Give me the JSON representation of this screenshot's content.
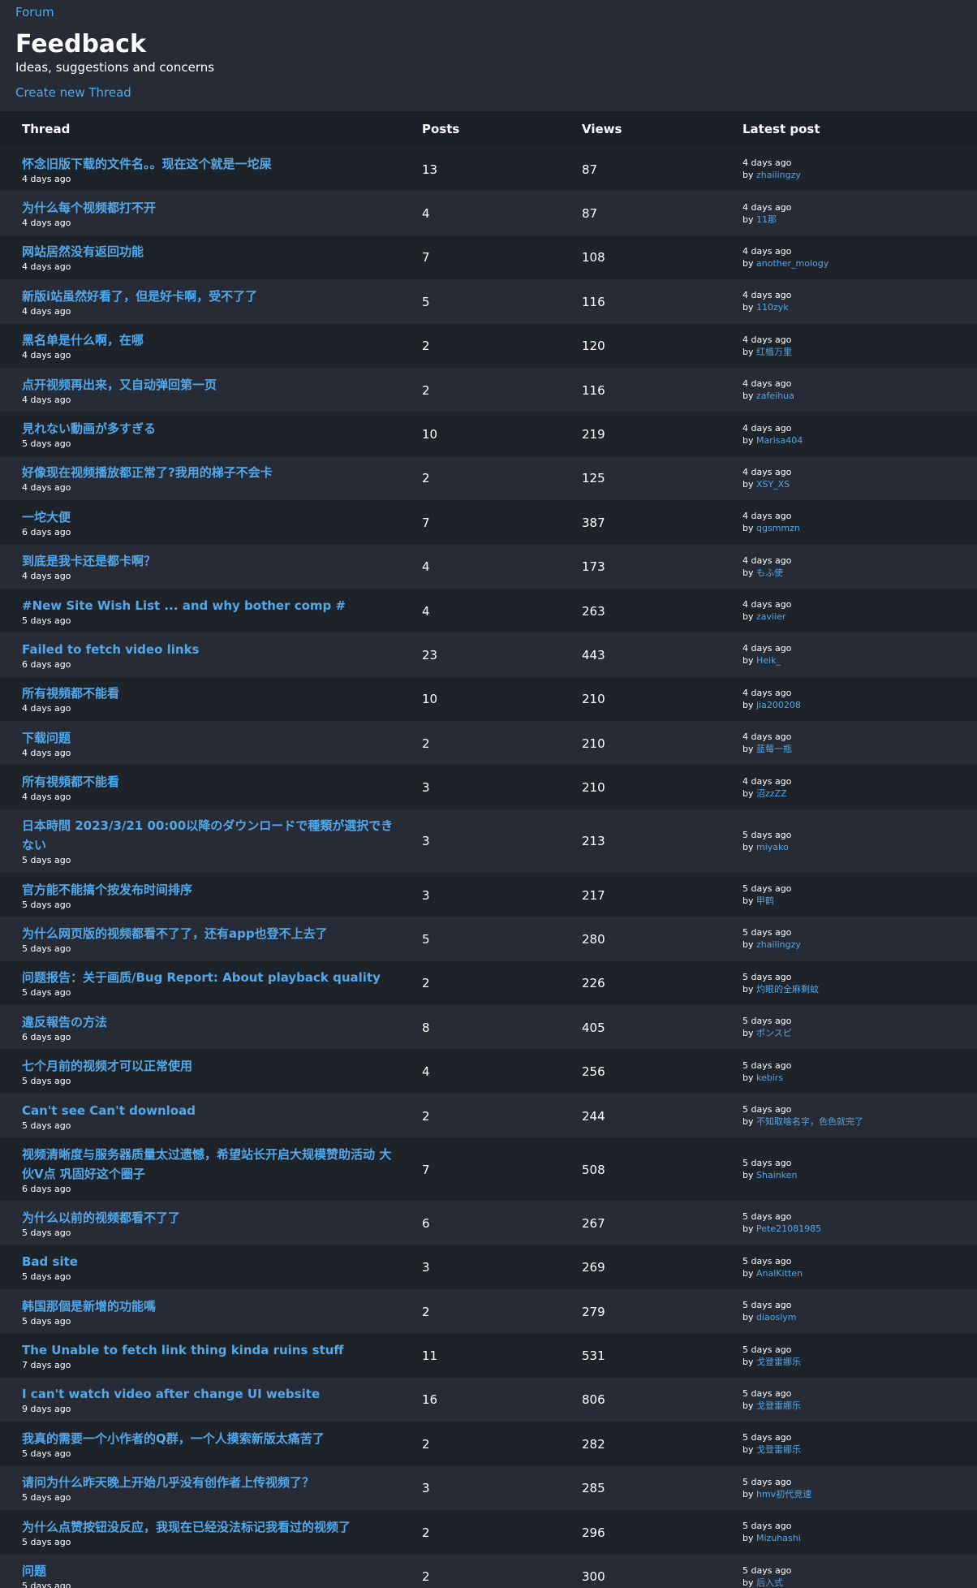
{
  "breadcrumb": {
    "label": "Forum"
  },
  "header": {
    "title": "Feedback",
    "subtitle": "Ideas, suggestions and concerns",
    "create_label": "Create new Thread"
  },
  "table": {
    "columns": [
      "Thread",
      "Posts",
      "Views",
      "Latest post"
    ],
    "by_label": "by",
    "rows": [
      {
        "title": "怀念旧版下载的文件名。。现在这个就是一坨屎",
        "date": "4 days ago",
        "posts": "13",
        "views": "87",
        "latest_date": "4 days ago",
        "latest_user": "zhailingzy"
      },
      {
        "title": "为什么每个视频都打不开",
        "date": "4 days ago",
        "posts": "4",
        "views": "87",
        "latest_date": "4 days ago",
        "latest_user": "11那"
      },
      {
        "title": "网站居然没有返回功能",
        "date": "4 days ago",
        "posts": "7",
        "views": "108",
        "latest_date": "4 days ago",
        "latest_user": "another_mology"
      },
      {
        "title": "新版i站虽然好看了，但是好卡啊，受不了了",
        "date": "4 days ago",
        "posts": "5",
        "views": "116",
        "latest_date": "4 days ago",
        "latest_user": "110zyk"
      },
      {
        "title": "黑名单是什么啊，在哪",
        "date": "4 days ago",
        "posts": "2",
        "views": "120",
        "latest_date": "4 days ago",
        "latest_user": "红樯万里"
      },
      {
        "title": "点开视频再出来，又自动弹回第一页",
        "date": "4 days ago",
        "posts": "2",
        "views": "116",
        "latest_date": "4 days ago",
        "latest_user": "zafeihua"
      },
      {
        "title": "見れない動画が多すぎる",
        "date": "5 days ago",
        "posts": "10",
        "views": "219",
        "latest_date": "4 days ago",
        "latest_user": "Marisa404"
      },
      {
        "title": "好像现在视频播放都正常了?我用的梯子不会卡",
        "date": "4 days ago",
        "posts": "2",
        "views": "125",
        "latest_date": "4 days ago",
        "latest_user": "XSY_XS"
      },
      {
        "title": "一坨大便",
        "date": "6 days ago",
        "posts": "7",
        "views": "387",
        "latest_date": "4 days ago",
        "latest_user": "qgsmmzn"
      },
      {
        "title": "到底是我卡还是都卡啊？",
        "date": "4 days ago",
        "posts": "4",
        "views": "173",
        "latest_date": "4 days ago",
        "latest_user": "もふ使"
      },
      {
        "title": "#New Site Wish List ... and why bother comp #",
        "date": "5 days ago",
        "posts": "4",
        "views": "263",
        "latest_date": "4 days ago",
        "latest_user": "zaviier"
      },
      {
        "title": "Failed to fetch video links",
        "date": "6 days ago",
        "posts": "23",
        "views": "443",
        "latest_date": "4 days ago",
        "latest_user": "Heik_"
      },
      {
        "title": "所有視頻都不能看",
        "date": "4 days ago",
        "posts": "10",
        "views": "210",
        "latest_date": "4 days ago",
        "latest_user": "jia200208"
      },
      {
        "title": "下载问题",
        "date": "4 days ago",
        "posts": "2",
        "views": "210",
        "latest_date": "4 days ago",
        "latest_user": "蓝莓一瓶"
      },
      {
        "title": "所有視頻都不能看",
        "date": "4 days ago",
        "posts": "3",
        "views": "210",
        "latest_date": "4 days ago",
        "latest_user": "沼zzZZ"
      },
      {
        "title": "日本時間 2023/3/21 00:00以降のダウンロードで種類が選択できない",
        "date": "5 days ago",
        "posts": "3",
        "views": "213",
        "latest_date": "5 days ago",
        "latest_user": "miyako",
        "tall": true
      },
      {
        "title": "官方能不能搞个按发布时间排序",
        "date": "5 days ago",
        "posts": "3",
        "views": "217",
        "latest_date": "5 days ago",
        "latest_user": "甲鹤"
      },
      {
        "title": "为什么网页版的视频都看不了了，还有app也登不上去了",
        "date": "5 days ago",
        "posts": "5",
        "views": "280",
        "latest_date": "5 days ago",
        "latest_user": "zhailingzy"
      },
      {
        "title": "问题报告：关于画质/Bug Report: About playback quality",
        "date": "5 days ago",
        "posts": "2",
        "views": "226",
        "latest_date": "5 days ago",
        "latest_user": "灼眼的全麻剩蚊"
      },
      {
        "title": "違反報告の方法",
        "date": "6 days ago",
        "posts": "8",
        "views": "405",
        "latest_date": "5 days ago",
        "latest_user": "ポンスピ"
      },
      {
        "title": "七个月前的视频才可以正常使用",
        "date": "5 days ago",
        "posts": "4",
        "views": "256",
        "latest_date": "5 days ago",
        "latest_user": "kebirs"
      },
      {
        "title": "Can't see Can't download",
        "date": "5 days ago",
        "posts": "2",
        "views": "244",
        "latest_date": "5 days ago",
        "latest_user": "不知取啥名字，色色就完了"
      },
      {
        "title": "视频清晰度与服务器质量太过遗憾，希望站长开启大规模赞助活动 大伙V点 巩固好这个圈子",
        "date": "6 days ago",
        "posts": "7",
        "views": "508",
        "latest_date": "5 days ago",
        "latest_user": "Shainken",
        "tall": true
      },
      {
        "title": "为什么以前的视频都看不了了",
        "date": "5 days ago",
        "posts": "6",
        "views": "267",
        "latest_date": "5 days ago",
        "latest_user": "Pete21081985"
      },
      {
        "title": "Bad site",
        "date": "5 days ago",
        "posts": "3",
        "views": "269",
        "latest_date": "5 days ago",
        "latest_user": "AnalKitten"
      },
      {
        "title": "韩国那個是新增的功能嗎",
        "date": "5 days ago",
        "posts": "2",
        "views": "279",
        "latest_date": "5 days ago",
        "latest_user": "diaoslym"
      },
      {
        "title": "The Unable to fetch link thing kinda ruins stuff",
        "date": "7 days ago",
        "posts": "11",
        "views": "531",
        "latest_date": "5 days ago",
        "latest_user": "戈登雷娜乐"
      },
      {
        "title": "I can't watch video after change UI website",
        "date": "9 days ago",
        "posts": "16",
        "views": "806",
        "latest_date": "5 days ago",
        "latest_user": "戈登雷娜乐"
      },
      {
        "title": "我真的需要一个小作者的Q群，一个人摸索新版太痛苦了",
        "date": "5 days ago",
        "posts": "2",
        "views": "282",
        "latest_date": "5 days ago",
        "latest_user": "戈登雷娜乐"
      },
      {
        "title": "请问为什么昨天晚上开始几乎没有创作者上传视频了？",
        "date": "5 days ago",
        "posts": "3",
        "views": "285",
        "latest_date": "5 days ago",
        "latest_user": "hmv初代竞速"
      },
      {
        "title": "为什么点赞按钮没反应，我现在已经没法标记我看过的视频了",
        "date": "5 days ago",
        "posts": "2",
        "views": "296",
        "latest_date": "5 days ago",
        "latest_user": "Mizuhashi"
      },
      {
        "title": "问题",
        "date": "5 days ago",
        "posts": "2",
        "views": "300",
        "latest_date": "5 days ago",
        "latest_user": "后入式"
      }
    ]
  }
}
